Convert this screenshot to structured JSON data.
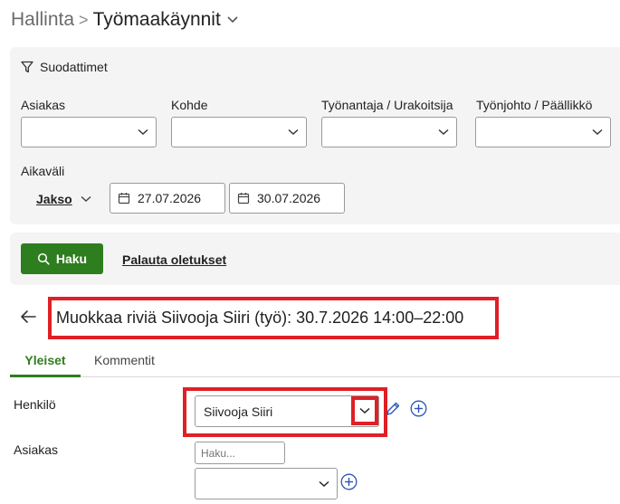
{
  "breadcrumb": {
    "parent": "Hallinta",
    "separator": ">",
    "current": "Työmaakäynnit"
  },
  "filters": {
    "title": "Suodattimet",
    "fields": [
      {
        "label": "Asiakas",
        "value": ""
      },
      {
        "label": "Kohde",
        "value": ""
      },
      {
        "label": "Työnantaja / Urakoitsija",
        "value": ""
      },
      {
        "label": "Työnjohto / Päällikkö",
        "value": ""
      }
    ],
    "period_label": "Aikaväli",
    "period_type": "Jakso",
    "date_start": "27.07.2026",
    "date_end": "30.07.2026"
  },
  "actions": {
    "search_label": "Haku",
    "reset_label": "Palauta oletukset"
  },
  "edit": {
    "title": "Muokkaa riviä Siivooja Siiri (työ): 30.7.2026 14:00–22:00"
  },
  "tabs": [
    {
      "label": "Yleiset",
      "active": true
    },
    {
      "label": "Kommentit",
      "active": false
    }
  ],
  "form": {
    "person_label": "Henkilö",
    "person_value": "Siivooja Siiri",
    "customer_label": "Asiakas",
    "customer_search_placeholder": "Haku...",
    "customer_value": ""
  },
  "colors": {
    "accent_green": "#2e7d1e",
    "highlight_red": "#e01f26",
    "panel_bg": "#f4f4f4"
  }
}
